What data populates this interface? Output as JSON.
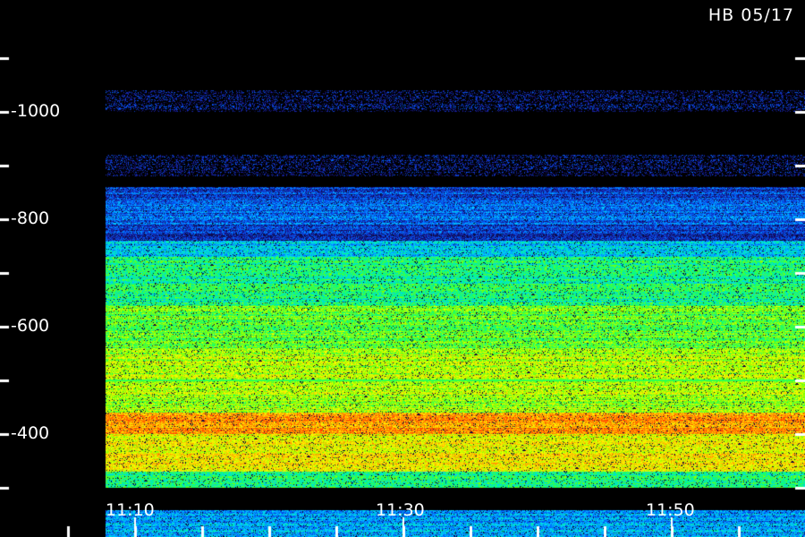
{
  "chart_data": {
    "type": "heatmap",
    "title": "",
    "station_label": "HB 05/17",
    "xlabel": "",
    "ylabel": "",
    "x_ticks": [
      "11:10",
      "11:30",
      "11:50"
    ],
    "y_ticks": [
      1000,
      800,
      600,
      400
    ],
    "y_minor_ticks": [
      1100,
      900,
      700,
      500,
      300
    ],
    "ylim": [
      300,
      1100
    ],
    "colormap": [
      "#000000",
      "#1a1a9a",
      "#0060ff",
      "#00d0ff",
      "#00ff80",
      "#80ff00",
      "#ffff00",
      "#ff9000",
      "#ff3000"
    ],
    "intensity_bands": [
      {
        "y_from": 1000,
        "y_to": 1040,
        "level": 0.12
      },
      {
        "y_from": 880,
        "y_to": 920,
        "level": 0.12
      },
      {
        "y_from": 830,
        "y_to": 860,
        "level": 0.2
      },
      {
        "y_from": 790,
        "y_to": 830,
        "level": 0.25
      },
      {
        "y_from": 760,
        "y_to": 790,
        "level": 0.18
      },
      {
        "y_from": 730,
        "y_to": 760,
        "level": 0.38
      },
      {
        "y_from": 640,
        "y_to": 730,
        "level": 0.5
      },
      {
        "y_from": 560,
        "y_to": 640,
        "level": 0.6
      },
      {
        "y_from": 500,
        "y_to": 560,
        "level": 0.68
      },
      {
        "y_from": 440,
        "y_to": 500,
        "level": 0.66
      },
      {
        "y_from": 400,
        "y_to": 440,
        "level": 0.86
      },
      {
        "y_from": 330,
        "y_to": 400,
        "level": 0.76
      },
      {
        "y_from": 300,
        "y_to": 330,
        "level": 0.5
      }
    ],
    "horizontal_lines": [
      500
    ],
    "grid": false,
    "legend": "none"
  }
}
